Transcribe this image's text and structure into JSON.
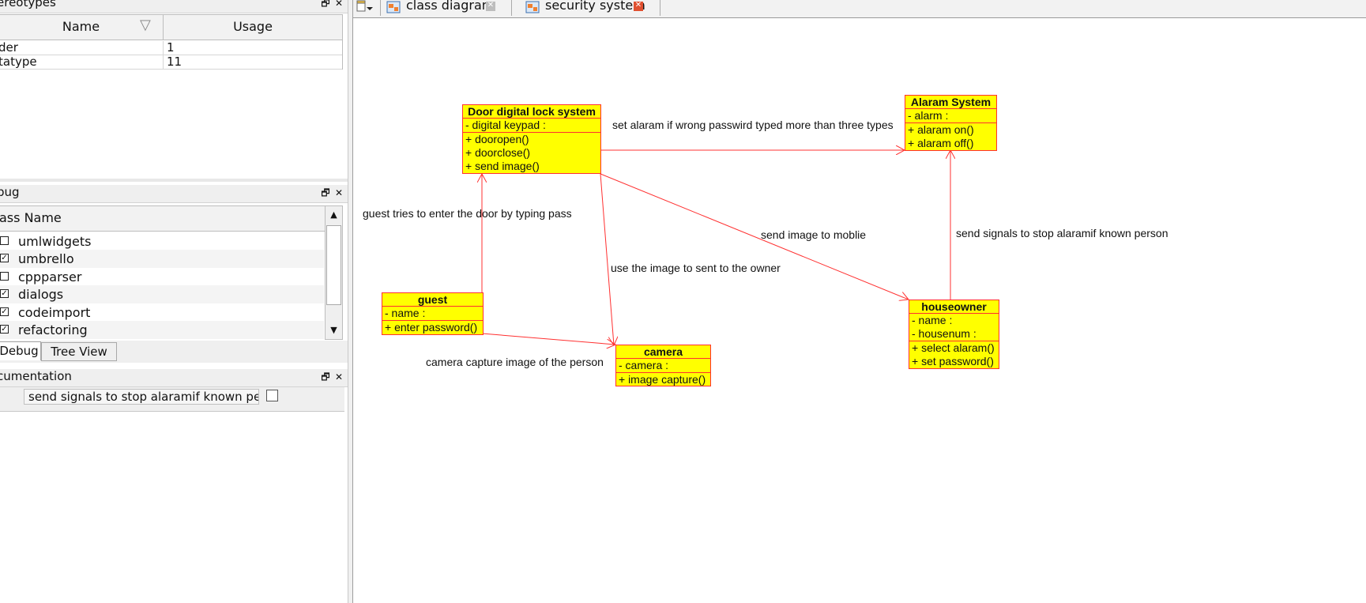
{
  "stereotypes_panel": {
    "title": "ereotypes",
    "columns": [
      "Name",
      "Usage"
    ],
    "rows": [
      {
        "name": "der",
        "usage": "1"
      },
      {
        "name": "tatype",
        "usage": "11"
      }
    ]
  },
  "debug_panel": {
    "title": "bug",
    "column": "ass Name",
    "items": [
      {
        "label": "umlwidgets",
        "checked": false
      },
      {
        "label": "umbrello",
        "checked": true
      },
      {
        "label": "cppparser",
        "checked": false
      },
      {
        "label": "dialogs",
        "checked": true
      },
      {
        "label": "codeimport",
        "checked": true
      },
      {
        "label": "refactoring",
        "checked": true
      }
    ],
    "tabs": [
      "Debug",
      "Tree View"
    ]
  },
  "documentation_panel": {
    "title": "cumentation",
    "text": "send signals to stop alaramif known person"
  },
  "dock_controls": {
    "float": "🗗",
    "close": "✕"
  },
  "toolbar": {
    "new_icon": "new-diagram-icon",
    "dropdown": "▾"
  },
  "diagram_tabs": [
    {
      "label": "class diagram",
      "icon": "class-diagram-icon",
      "close": "✕"
    },
    {
      "label": "security system",
      "icon": "class-diagram-icon",
      "close": "✕"
    }
  ],
  "classes": {
    "door": {
      "name": "Door digital lock system",
      "attributes": [
        "- digital keypad :"
      ],
      "operations": [
        "+ dooropen()",
        "+ doorclose()",
        "+ send image()"
      ]
    },
    "alarm": {
      "name": "Alaram System",
      "attributes": [
        "- alarm :"
      ],
      "operations": [
        "+ alaram on()",
        "+ alaram off()"
      ]
    },
    "guest": {
      "name": "guest",
      "attributes": [
        "- name :"
      ],
      "operations": [
        "+ enter password()"
      ]
    },
    "camera": {
      "name": "camera",
      "attributes": [
        "- camera :"
      ],
      "operations": [
        "+ image capture()"
      ]
    },
    "houseowner": {
      "name": "houseowner",
      "attributes": [
        "- name :",
        "- housenum :"
      ],
      "operations": [
        "+ select alaram()",
        "+ set password()"
      ]
    }
  },
  "associations": {
    "door_alarm": "set alaram if wrong passwird typed more than three types",
    "guest_door": "guest tries to enter the door by  typing pass",
    "door_owner": "send image to moblie",
    "owner_alarm": "send signals to stop alaramif known person",
    "door_camera": "use the image to sent to the owner",
    "guest_camera": "camera capture image of the person"
  },
  "colors": {
    "class_fill": "#ffff00",
    "class_border": "#ff3030",
    "association": "#ff3030"
  }
}
